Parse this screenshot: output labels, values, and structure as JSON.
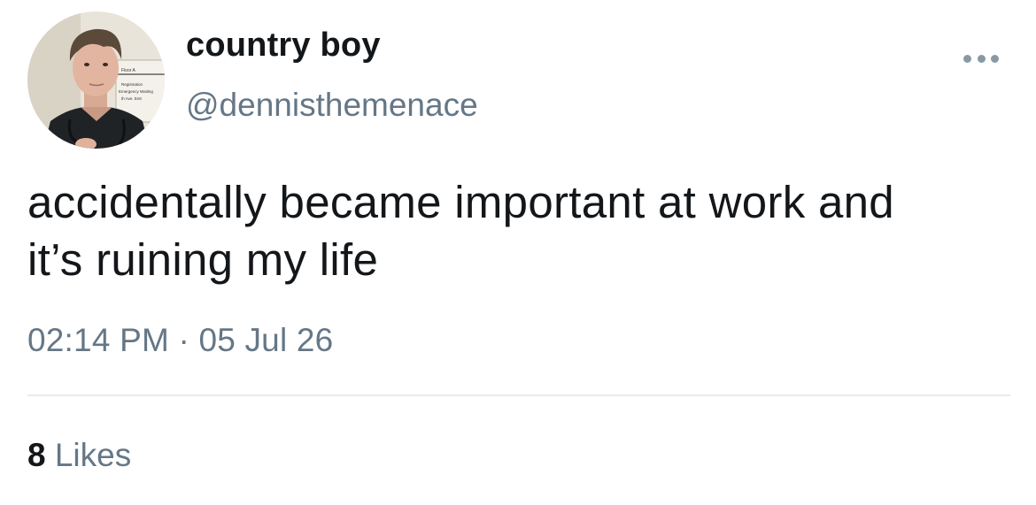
{
  "user": {
    "display_name": "country boy",
    "handle": "@dennisthemenace",
    "avatar_sign": {
      "line1": "Floor A",
      "line2": "Registration",
      "line3": "Emergency Waiting",
      "line4": "th Ave. Entr"
    }
  },
  "tweet": {
    "text_line1": "accidentally became important at work and",
    "text_line2": "it’s ruining my life",
    "timestamp": "02:14 PM · 05 Jul 26"
  },
  "engagement": {
    "likes_count": "8",
    "likes_label": "Likes"
  },
  "icons": {
    "more": "more-horizontal-icon"
  },
  "colors": {
    "text_primary": "#14171a",
    "text_secondary": "#657786",
    "divider": "#e6ecf0",
    "more_dots": "#8899a6"
  }
}
